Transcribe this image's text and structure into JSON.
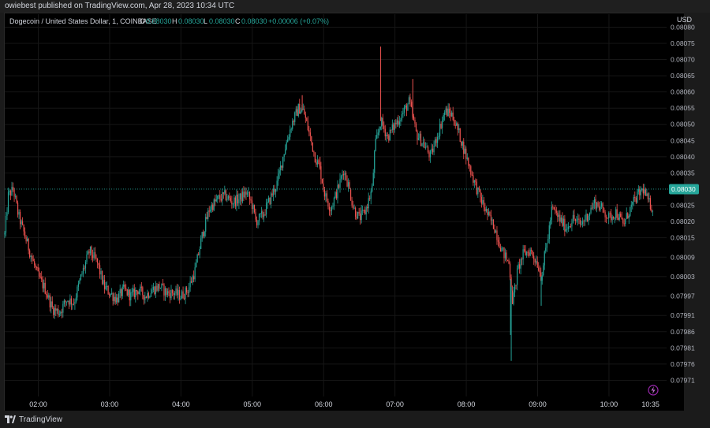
{
  "publisher_line": "owiebest published on TradingView.com, Apr 28, 2023 10:34 UTC",
  "brand": "TradingView",
  "colors": {
    "up": "#26a69a",
    "down": "#ef5350",
    "background": "#000000",
    "grid": "#161616",
    "last_price_bg": "#26a69a",
    "text": "#d1d4dc",
    "dim_text": "#b2b5be",
    "lightning": "#9c27b0"
  },
  "legend": {
    "symbol": "Dogecoin / United States Dollar, 1, COINBASE",
    "o_label": "O",
    "o_value": "0.08030",
    "h_label": "H",
    "h_value": "0.08030",
    "l_label": "L",
    "l_value": "0.08030",
    "c_label": "C",
    "c_value": "0.08030",
    "change": "+0.00006 (+0.07%)"
  },
  "price_axis": {
    "currency": "USD",
    "last_price": "0.08030",
    "tick_labels": [
      "0.08080",
      "0.08075",
      "0.08070",
      "0.08065",
      "0.08060",
      "0.08055",
      "0.08050",
      "0.08045",
      "0.08040",
      "0.08035",
      "0.08025",
      "0.08020",
      "0.08015",
      "0.08009",
      "0.08003",
      "0.07997",
      "0.07991",
      "0.07986",
      "0.07981",
      "0.07976",
      "0.07971"
    ]
  },
  "time_axis": {
    "labels": [
      "02:00",
      "03:00",
      "04:00",
      "05:00",
      "06:00",
      "07:00",
      "08:00",
      "09:00",
      "10:00",
      "10:35"
    ]
  },
  "chart_data": {
    "type": "candlestick",
    "interval_minutes": 1,
    "y_range": [
      0.07966,
      0.08084
    ],
    "x_range_hours": [
      1.53,
      10.62
    ],
    "last_price": 0.0803,
    "anchors": [
      [
        1.53,
        0.08016
      ],
      [
        1.58,
        0.08028
      ],
      [
        1.65,
        0.0803
      ],
      [
        1.72,
        0.08022
      ],
      [
        1.82,
        0.08015
      ],
      [
        1.92,
        0.08008
      ],
      [
        2.0,
        0.08003
      ],
      [
        2.1,
        0.07999
      ],
      [
        2.2,
        0.07993
      ],
      [
        2.3,
        0.07992
      ],
      [
        2.4,
        0.07996
      ],
      [
        2.5,
        0.07995
      ],
      [
        2.6,
        0.08003
      ],
      [
        2.72,
        0.08011
      ],
      [
        2.83,
        0.08007
      ],
      [
        2.92,
        0.08
      ],
      [
        3.0,
        0.07998
      ],
      [
        3.1,
        0.07996
      ],
      [
        3.2,
        0.07999
      ],
      [
        3.3,
        0.07997
      ],
      [
        3.4,
        0.07999
      ],
      [
        3.5,
        0.07997
      ],
      [
        3.6,
        0.07999
      ],
      [
        3.7,
        0.08
      ],
      [
        3.8,
        0.07998
      ],
      [
        3.9,
        0.07998
      ],
      [
        4.0,
        0.07997
      ],
      [
        4.1,
        0.07999
      ],
      [
        4.2,
        0.08005
      ],
      [
        4.3,
        0.08016
      ],
      [
        4.4,
        0.08024
      ],
      [
        4.52,
        0.08027
      ],
      [
        4.62,
        0.08028
      ],
      [
        4.72,
        0.08026
      ],
      [
        4.82,
        0.08027
      ],
      [
        4.92,
        0.08029
      ],
      [
        5.0,
        0.08025
      ],
      [
        5.05,
        0.0802
      ],
      [
        5.15,
        0.08022
      ],
      [
        5.25,
        0.08027
      ],
      [
        5.35,
        0.08032
      ],
      [
        5.45,
        0.08042
      ],
      [
        5.55,
        0.0805
      ],
      [
        5.65,
        0.08055
      ],
      [
        5.72,
        0.08054
      ],
      [
        5.8,
        0.08047
      ],
      [
        5.88,
        0.0804
      ],
      [
        5.95,
        0.08036
      ],
      [
        6.02,
        0.08028
      ],
      [
        6.1,
        0.08024
      ],
      [
        6.2,
        0.0803
      ],
      [
        6.28,
        0.08036
      ],
      [
        6.35,
        0.08031
      ],
      [
        6.42,
        0.08024
      ],
      [
        6.5,
        0.08021
      ],
      [
        6.58,
        0.08023
      ],
      [
        6.68,
        0.0803
      ],
      [
        6.72,
        0.08043
      ],
      [
        6.8,
        0.08051
      ],
      [
        6.9,
        0.08046
      ],
      [
        7.0,
        0.0805
      ],
      [
        7.1,
        0.08053
      ],
      [
        7.2,
        0.08057
      ],
      [
        7.3,
        0.08047
      ],
      [
        7.4,
        0.08044
      ],
      [
        7.5,
        0.0804
      ],
      [
        7.6,
        0.08047
      ],
      [
        7.7,
        0.08054
      ],
      [
        7.8,
        0.08053
      ],
      [
        7.9,
        0.08047
      ],
      [
        8.0,
        0.0804
      ],
      [
        8.1,
        0.08033
      ],
      [
        8.2,
        0.08027
      ],
      [
        8.3,
        0.08022
      ],
      [
        8.4,
        0.08018
      ],
      [
        8.5,
        0.08011
      ],
      [
        8.6,
        0.08007
      ],
      [
        8.65,
        0.07995
      ],
      [
        8.72,
        0.08005
      ],
      [
        8.8,
        0.0801
      ],
      [
        8.9,
        0.08011
      ],
      [
        9.0,
        0.08007
      ],
      [
        9.05,
        0.08003
      ],
      [
        9.15,
        0.08016
      ],
      [
        9.2,
        0.08024
      ],
      [
        9.3,
        0.08021
      ],
      [
        9.4,
        0.08018
      ],
      [
        9.5,
        0.08021
      ],
      [
        9.6,
        0.08019
      ],
      [
        9.7,
        0.08022
      ],
      [
        9.8,
        0.08026
      ],
      [
        9.9,
        0.08024
      ],
      [
        10.0,
        0.08021
      ],
      [
        10.1,
        0.08023
      ],
      [
        10.2,
        0.08019
      ],
      [
        10.3,
        0.08024
      ],
      [
        10.4,
        0.08028
      ],
      [
        10.48,
        0.0803
      ],
      [
        10.55,
        0.08026
      ],
      [
        10.62,
        0.08024
      ]
    ],
    "spikes": [
      {
        "x": 6.8,
        "high": 0.08074
      },
      {
        "x": 7.25,
        "high": 0.08064
      },
      {
        "x": 8.63,
        "low": 0.07977
      },
      {
        "x": 8.62,
        "low": 0.07985
      },
      {
        "x": 9.05,
        "low": 0.07994
      },
      {
        "x": 5.7,
        "high": 0.08059
      },
      {
        "x": 5.95,
        "high": 0.0804
      }
    ]
  }
}
